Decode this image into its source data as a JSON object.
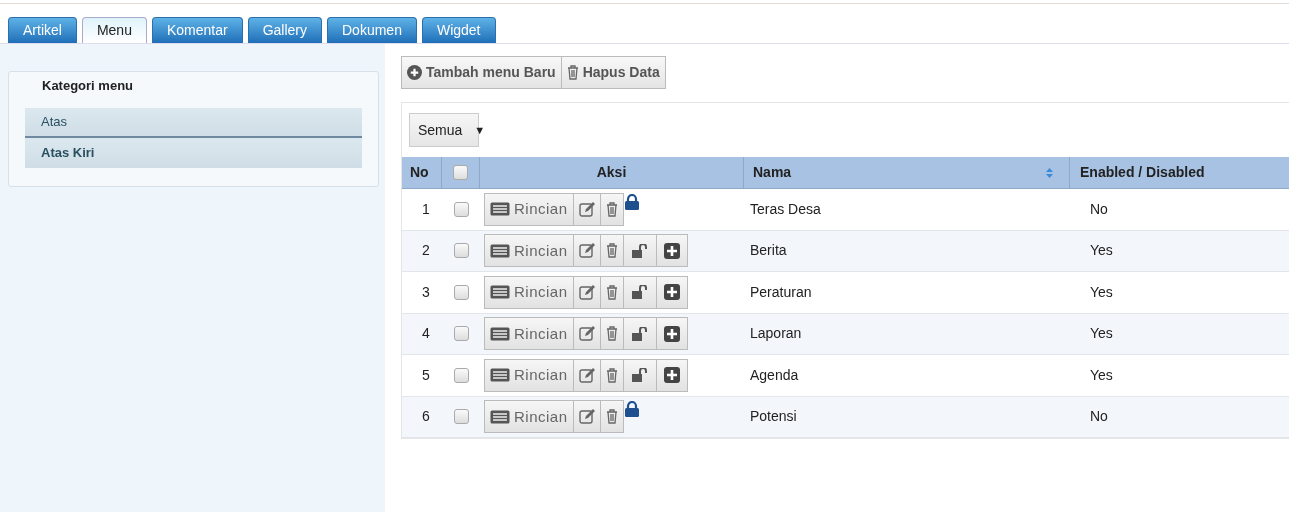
{
  "tabs": [
    {
      "label": "Artikel",
      "selected": false
    },
    {
      "label": "Menu",
      "selected": true
    },
    {
      "label": "Komentar",
      "selected": false
    },
    {
      "label": "Gallery",
      "selected": false
    },
    {
      "label": "Dokumen",
      "selected": false
    },
    {
      "label": "Wigdet",
      "selected": false
    }
  ],
  "sidebar": {
    "title": "Kategori menu",
    "items": [
      {
        "label": "Atas",
        "selected": false
      },
      {
        "label": "Atas Kiri",
        "selected": true
      }
    ]
  },
  "toolbar": {
    "add_button": "Tambah menu Baru",
    "delete_button": "Hapus Data"
  },
  "filter": {
    "value": "Semua",
    "caret": "▼"
  },
  "table": {
    "columns": [
      "No",
      "Aksi",
      "Nama",
      "Enabled / Disabled"
    ],
    "select_all_checked": false,
    "rows": [
      {
        "no": "1",
        "checked": false,
        "detail": "Rincian",
        "locked": true,
        "name": "Teras Desa",
        "enabled": "No"
      },
      {
        "no": "2",
        "checked": false,
        "detail": "Rincian",
        "locked": false,
        "name": "Berita",
        "enabled": "Yes"
      },
      {
        "no": "3",
        "checked": false,
        "detail": "Rincian",
        "locked": false,
        "name": "Peraturan",
        "enabled": "Yes"
      },
      {
        "no": "4",
        "checked": false,
        "detail": "Rincian",
        "locked": false,
        "name": "Laporan",
        "enabled": "Yes"
      },
      {
        "no": "5",
        "checked": false,
        "detail": "Rincian",
        "locked": false,
        "name": "Agenda",
        "enabled": "Yes"
      },
      {
        "no": "6",
        "checked": false,
        "detail": "Rincian",
        "locked": true,
        "name": "Potensi",
        "enabled": "No"
      }
    ]
  }
}
